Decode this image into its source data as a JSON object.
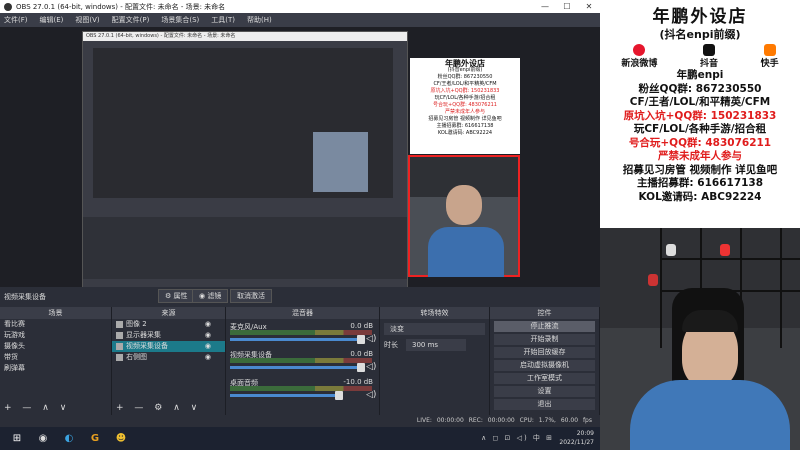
{
  "window": {
    "title": "OBS 27.0.1 (64-bit, windows) - 配置文件: 未命名 - 场景: 未命名",
    "controls": [
      "—",
      "☐",
      "✕"
    ]
  },
  "menu": [
    "文件(F)",
    "编辑(E)",
    "视图(V)",
    "配置文件(P)",
    "场景集合(S)",
    "工具(T)",
    "帮助(H)"
  ],
  "preview": {
    "inner_title": "OBS 27.0.1 (64-bit, windows) - 配置文件: 未命名 - 场景: 未命名",
    "inner_poster": [
      "年鹏外设店",
      "(抖音enpi前缀)",
      "粉丝QQ群: 867230550",
      "CF/王者/LOL/和平精英/CFM",
      "原坑入坑+QQ群: 150231833",
      "玩CF/LOL/各种手游/招合租",
      "号合玩+QQ群: 483076211",
      "严禁未成年人参与",
      "招募见习房管 视频制作 详见鱼吧",
      "主播招募群: 616617138",
      "KOL邀请码: ABC92224"
    ]
  },
  "source_bar": {
    "label": "视频采集设备",
    "properties": "属性",
    "filters": "滤镜",
    "deactivate": "取消激活"
  },
  "scenes": {
    "header": "场景",
    "items": [
      "看比赛",
      "玩游戏",
      "摄像头",
      "带货",
      "刷弹幕"
    ],
    "footer": "+ — ∧ ∨"
  },
  "sources": {
    "header": "来源",
    "items": [
      {
        "name": "图像 2",
        "selected": false
      },
      {
        "name": "显示器采集",
        "selected": false
      },
      {
        "name": "视频采集设备",
        "selected": true
      },
      {
        "name": "右侧图",
        "selected": false
      }
    ],
    "footer": "+ — ⚙ ∧ ∨"
  },
  "mixer": {
    "header": "混音器",
    "channels": [
      {
        "name": "麦克风/Aux",
        "db": "0.0 dB"
      },
      {
        "name": "视频采集设备",
        "db": "0.0 dB"
      },
      {
        "name": "桌面音频",
        "db": "-10.0 dB"
      }
    ]
  },
  "transitions": {
    "header": "转场特效",
    "type": "淡变",
    "duration_label": "时长",
    "duration_value": "300 ms"
  },
  "controls": {
    "header": "控件",
    "buttons": [
      "停止推流",
      "开始录制",
      "开始回放缓存",
      "启动虚拟摄像机",
      "工作室模式",
      "设置",
      "退出"
    ]
  },
  "status": {
    "live": "LIVE: 00:00:00",
    "rec": "REC: 00:00:00",
    "cpu": "CPU: 1.7%, 60.00 fps"
  },
  "taskbar": {
    "icons": [
      "windows-icon",
      "obs-icon",
      "edge-icon",
      "g-icon",
      "app-icon"
    ],
    "tray": "∧ ◻ ⊡ ◁) 中 ⊞",
    "time": "20:09",
    "date": "2022/11/27"
  },
  "poster": {
    "title": "年鹏外设店",
    "subtitle": "(抖名enpi前缀)",
    "socials": [
      "新浪微博",
      "抖音",
      "快手"
    ],
    "handle": "年鹏enpi",
    "lines": [
      {
        "text": "粉丝QQ群: 867230550",
        "red": false
      },
      {
        "text": "CF/王者/LOL/和平精英/CFM",
        "red": false
      },
      {
        "text": "原坑入坑+QQ群: 150231833",
        "red": true
      },
      {
        "text": "玩CF/LOL/各种手游/招合租",
        "red": false
      },
      {
        "text": "号合玩+QQ群: 483076211",
        "red": true
      },
      {
        "text": "严禁未成年人参与",
        "red": true
      },
      {
        "text": "招募见习房管 视频制作 详见鱼吧",
        "red": false
      },
      {
        "text": "主播招募群: 616617138",
        "red": false
      },
      {
        "text": "KOL邀请码: ABC92224",
        "red": false
      }
    ]
  },
  "colors": {
    "accent_red": "#e01c1c",
    "selection": "#1c7a8a",
    "obs_bg": "#2b2e38"
  }
}
